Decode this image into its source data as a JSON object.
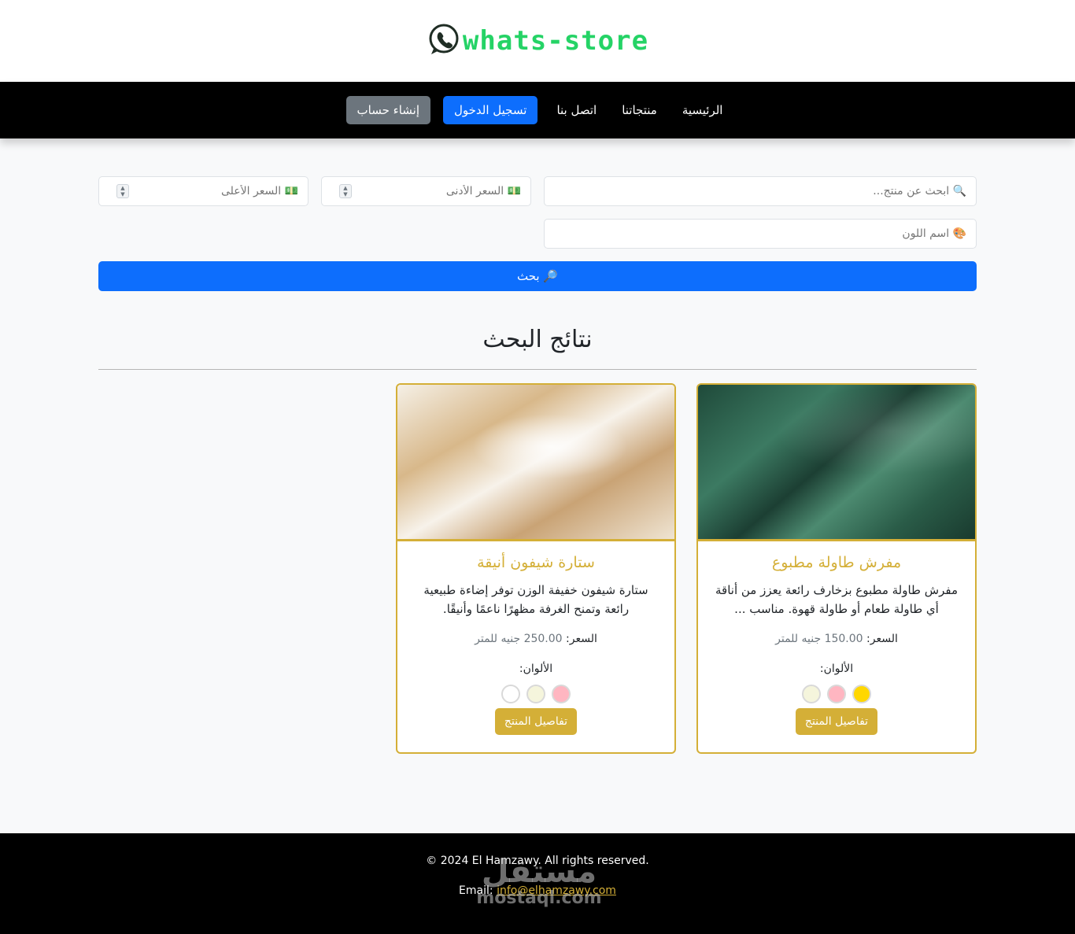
{
  "brand": {
    "logo_text": "whats-store",
    "accent_color": "#25d366"
  },
  "nav": {
    "items": [
      {
        "label": "الرئيسية"
      },
      {
        "label": "منتجاتنا"
      },
      {
        "label": "اتصل بنا"
      }
    ],
    "login_label": "تسجيل الدخول",
    "register_label": "إنشاء حساب"
  },
  "search": {
    "query_placeholder": "🔍 ابحث عن منتج...",
    "min_price_placeholder": "💵 السعر الأدنى",
    "max_price_placeholder": "💵 السعر الأعلى",
    "color_placeholder": "🎨 اسم اللون",
    "submit_label": "🔎 بحث"
  },
  "results": {
    "title": "نتائج البحث",
    "products": [
      {
        "name": "مفرش طاولة مطبوع",
        "description": "مفرش طاولة مطبوع بزخارف رائعة يعزز من أناقة أي طاولة طعام أو طاولة قهوة. مناسب ...",
        "price_label": "السعر:",
        "price_value": "150.00 جنيه للمتر",
        "colors_label": "الألوان:",
        "colors": [
          "#ffd700",
          "#ffb6c1",
          "#f5f5dc"
        ],
        "details_label": "تفاصيل المنتج"
      },
      {
        "name": "ستارة شيفون أنيقة",
        "description": "ستارة شيفون خفيفة الوزن توفر إضاءة طبيعية رائعة وتمنح الغرفة مظهرًا ناعمًا وأنيقًا.",
        "price_label": "السعر:",
        "price_value": "250.00 جنيه للمتر",
        "colors_label": "الألوان:",
        "colors": [
          "#ffb6c1",
          "#f5f5dc",
          "#ffffff"
        ],
        "details_label": "تفاصيل المنتج"
      }
    ]
  },
  "footer": {
    "copyright": "© 2024 El Hamzawy. All rights reserved.",
    "email_label": "Email:",
    "email": "info@elhamzawy.com"
  },
  "watermark": {
    "arabic": "مستقل",
    "latin": "mostaql.com"
  },
  "theme": {
    "gold": "#d4af37",
    "primary": "#0d6efd",
    "secondary": "#6c757d"
  }
}
